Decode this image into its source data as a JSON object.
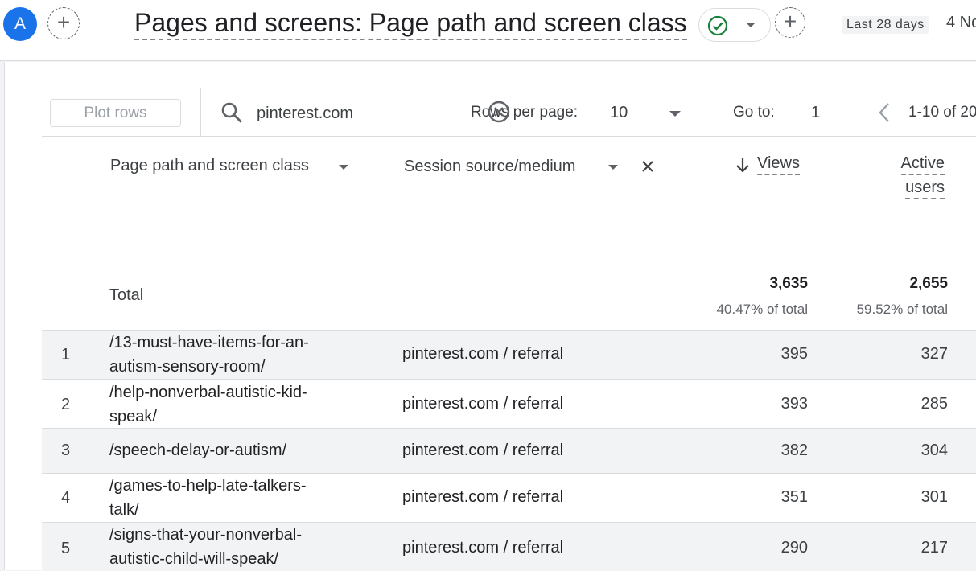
{
  "header": {
    "avatar_letter": "A",
    "report_title": "Pages and screens: Page path and screen class",
    "date_label": "Last 28 days",
    "date_range": "4 No"
  },
  "toolbar": {
    "plot_rows": "Plot rows",
    "search_value": "pinterest.com",
    "rows_per_page_label": "Rows per page:",
    "rows_per_page_value": "10",
    "goto_label": "Go to:",
    "goto_value": "1",
    "range_text": "1-10 of 20"
  },
  "table": {
    "dim1_header": "Page path and screen class",
    "dim2_header": "Session source/medium",
    "views_header": "Views",
    "active_users_line1": "Active",
    "active_users_line2": "users",
    "total_label": "Total",
    "total_views": "3,635",
    "total_views_pct": "40.47% of total",
    "total_users": "2,655",
    "total_users_pct": "59.52% of total",
    "rows": [
      {
        "idx": "1",
        "path_line1": "/13-must-have-items-for-an-",
        "path_line2": "autism-sensory-room/",
        "source": "pinterest.com / referral",
        "views": "395",
        "users": "327"
      },
      {
        "idx": "2",
        "path_line1": "/help-nonverbal-autistic-kid-",
        "path_line2": "speak/",
        "source": "pinterest.com / referral",
        "views": "393",
        "users": "285"
      },
      {
        "idx": "3",
        "path_line1": "/speech-delay-or-autism/",
        "path_line2": "",
        "source": "pinterest.com / referral",
        "views": "382",
        "users": "304"
      },
      {
        "idx": "4",
        "path_line1": "/games-to-help-late-talkers-",
        "path_line2": "talk/",
        "source": "pinterest.com / referral",
        "views": "351",
        "users": "301"
      },
      {
        "idx": "5",
        "path_line1": "/signs-that-your-nonverbal-",
        "path_line2": "autistic-child-will-speak/",
        "source": "pinterest.com / referral",
        "views": "290",
        "users": "217"
      }
    ]
  },
  "colors": {
    "accent": "#1a73e8",
    "success": "#188038"
  }
}
